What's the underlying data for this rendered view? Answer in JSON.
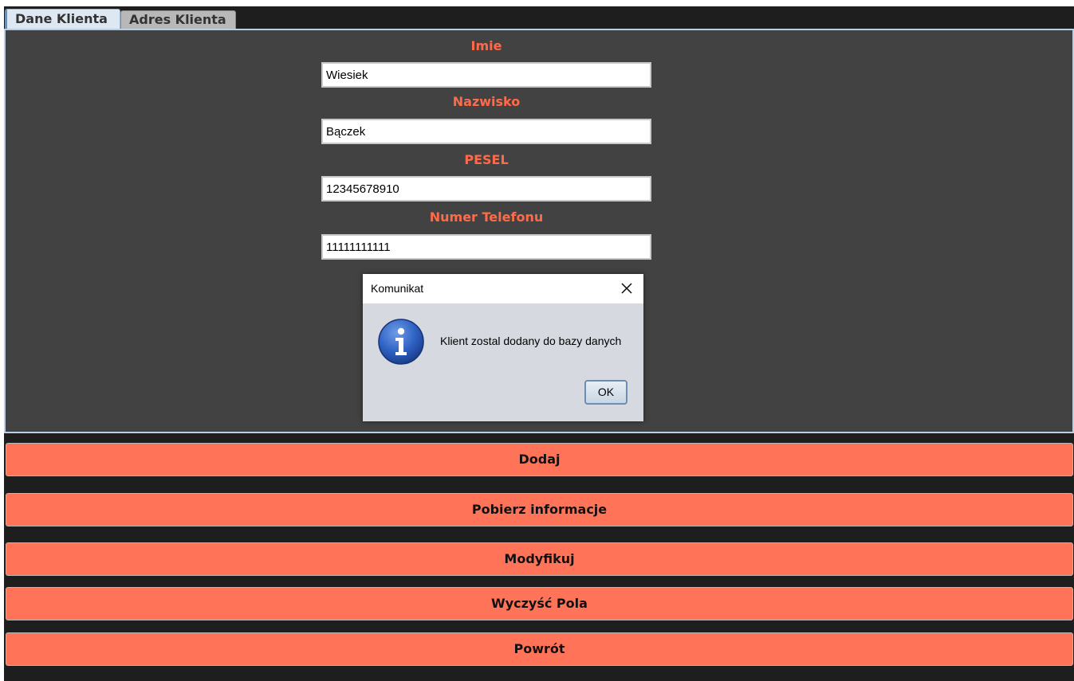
{
  "tabs": [
    {
      "label": "Dane Klienta",
      "active": true
    },
    {
      "label": "Adres Klienta",
      "active": false
    }
  ],
  "form": {
    "fields": [
      {
        "label": "Imie",
        "value": "Wiesiek"
      },
      {
        "label": "Nazwisko",
        "value": "Bączek"
      },
      {
        "label": "PESEL",
        "value": "12345678910"
      },
      {
        "label": "Numer Telefonu",
        "value": "11111111111"
      }
    ]
  },
  "dialog": {
    "title": "Komunikat",
    "message": "Klient zostal dodany do bazy danych",
    "ok_label": "OK",
    "icon": "info-icon"
  },
  "actions": [
    {
      "label": "Dodaj"
    },
    {
      "label": "Pobierz informacje"
    },
    {
      "label": "Modyfikuj"
    },
    {
      "label": "Wyczyść Pola"
    },
    {
      "label": "Powrót"
    }
  ],
  "colors": {
    "accent": "#ff6b4a",
    "button": "#ff7458",
    "panel": "#424242",
    "app_bg": "#1e1e1e",
    "tab_active": "#dde8f3",
    "tab_inactive": "#b8b8b8",
    "dialog_bg": "#d6d9e0"
  }
}
